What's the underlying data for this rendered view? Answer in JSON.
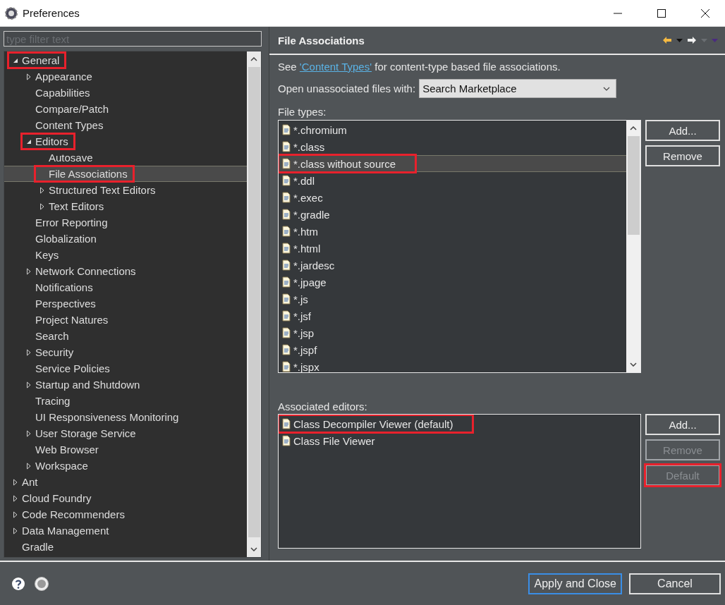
{
  "window": {
    "title": "Preferences"
  },
  "filter": {
    "placeholder": "type filter text"
  },
  "tree": [
    {
      "label": "General",
      "expanded": true,
      "selected": false,
      "annotated": true,
      "children": [
        {
          "label": "Appearance",
          "expanded": false,
          "selected": false,
          "annotated": false
        },
        {
          "label": "Capabilities",
          "selected": false,
          "annotated": false
        },
        {
          "label": "Compare/Patch",
          "selected": false,
          "annotated": false
        },
        {
          "label": "Content Types",
          "selected": false,
          "annotated": false
        },
        {
          "label": "Editors",
          "expanded": true,
          "selected": false,
          "annotated": true,
          "children": [
            {
              "label": "Autosave",
              "selected": false,
              "annotated": false
            },
            {
              "label": "File Associations",
              "selected": true,
              "annotated": true
            },
            {
              "label": "Structured Text Editors",
              "expanded": false,
              "selected": false,
              "annotated": false
            },
            {
              "label": "Text Editors",
              "expanded": false,
              "selected": false,
              "annotated": false
            }
          ]
        },
        {
          "label": "Error Reporting",
          "selected": false,
          "annotated": false
        },
        {
          "label": "Globalization",
          "selected": false,
          "annotated": false
        },
        {
          "label": "Keys",
          "selected": false,
          "annotated": false
        },
        {
          "label": "Network Connections",
          "expanded": false,
          "selected": false,
          "annotated": false
        },
        {
          "label": "Notifications",
          "selected": false,
          "annotated": false
        },
        {
          "label": "Perspectives",
          "selected": false,
          "annotated": false
        },
        {
          "label": "Project Natures",
          "selected": false,
          "annotated": false
        },
        {
          "label": "Search",
          "selected": false,
          "annotated": false
        },
        {
          "label": "Security",
          "expanded": false,
          "selected": false,
          "annotated": false
        },
        {
          "label": "Service Policies",
          "selected": false,
          "annotated": false
        },
        {
          "label": "Startup and Shutdown",
          "expanded": false,
          "selected": false,
          "annotated": false
        },
        {
          "label": "Tracing",
          "selected": false,
          "annotated": false
        },
        {
          "label": "UI Responsiveness Monitoring",
          "selected": false,
          "annotated": false
        },
        {
          "label": "User Storage Service",
          "expanded": false,
          "selected": false,
          "annotated": false
        },
        {
          "label": "Web Browser",
          "selected": false,
          "annotated": false
        },
        {
          "label": "Workspace",
          "expanded": false,
          "selected": false,
          "annotated": false
        }
      ]
    },
    {
      "label": "Ant",
      "expanded": false,
      "selected": false,
      "annotated": false
    },
    {
      "label": "Cloud Foundry",
      "expanded": false,
      "selected": false,
      "annotated": false
    },
    {
      "label": "Code Recommenders",
      "expanded": false,
      "selected": false,
      "annotated": false
    },
    {
      "label": "Data Management",
      "expanded": false,
      "selected": false,
      "annotated": false
    },
    {
      "label": "Gradle",
      "selected": false,
      "annotated": false
    }
  ],
  "page": {
    "title": "File Associations",
    "intro_before": "See",
    "link": "'Content Types'",
    "intro_after": "for content-type based file associations.",
    "open_with": {
      "label": "Open unassociated files with:",
      "value": "Search Marketplace"
    },
    "file_types": {
      "label": "File types:",
      "items": [
        {
          "name": "*.chromium",
          "selected": false,
          "annotated": false
        },
        {
          "name": "*.class",
          "selected": false,
          "annotated": false
        },
        {
          "name": "*.class without source",
          "selected": true,
          "annotated": true
        },
        {
          "name": "*.ddl",
          "selected": false,
          "annotated": false
        },
        {
          "name": "*.exec",
          "selected": false,
          "annotated": false
        },
        {
          "name": "*.gradle",
          "selected": false,
          "annotated": false
        },
        {
          "name": "*.htm",
          "selected": false,
          "annotated": false
        },
        {
          "name": "*.html",
          "selected": false,
          "annotated": false
        },
        {
          "name": "*.jardesc",
          "selected": false,
          "annotated": false
        },
        {
          "name": "*.jpage",
          "selected": false,
          "annotated": false
        },
        {
          "name": "*.js",
          "selected": false,
          "annotated": false
        },
        {
          "name": "*.jsf",
          "selected": false,
          "annotated": false
        },
        {
          "name": "*.jsp",
          "selected": false,
          "annotated": false
        },
        {
          "name": "*.jspf",
          "selected": false,
          "annotated": false
        },
        {
          "name": "*.jspx",
          "selected": false,
          "annotated": false
        }
      ],
      "buttons": [
        {
          "label": "Add...",
          "disabled": false,
          "annotated": false
        },
        {
          "label": "Remove",
          "disabled": false,
          "annotated": false
        }
      ]
    },
    "associated_editors": {
      "label": "Associated editors:",
      "items": [
        {
          "name": "Class Decompiler Viewer (default)",
          "selected": false,
          "annotated": true
        },
        {
          "name": "Class File Viewer",
          "selected": false,
          "annotated": false
        }
      ],
      "buttons": [
        {
          "label": "Add...",
          "disabled": false,
          "annotated": false
        },
        {
          "label": "Remove",
          "disabled": true,
          "annotated": false
        },
        {
          "label": "Default",
          "disabled": true,
          "annotated": true
        }
      ]
    }
  },
  "footer": {
    "buttons": [
      {
        "label": "Apply and Close",
        "kind": "primary"
      },
      {
        "label": "Cancel",
        "kind": "normal"
      }
    ]
  }
}
